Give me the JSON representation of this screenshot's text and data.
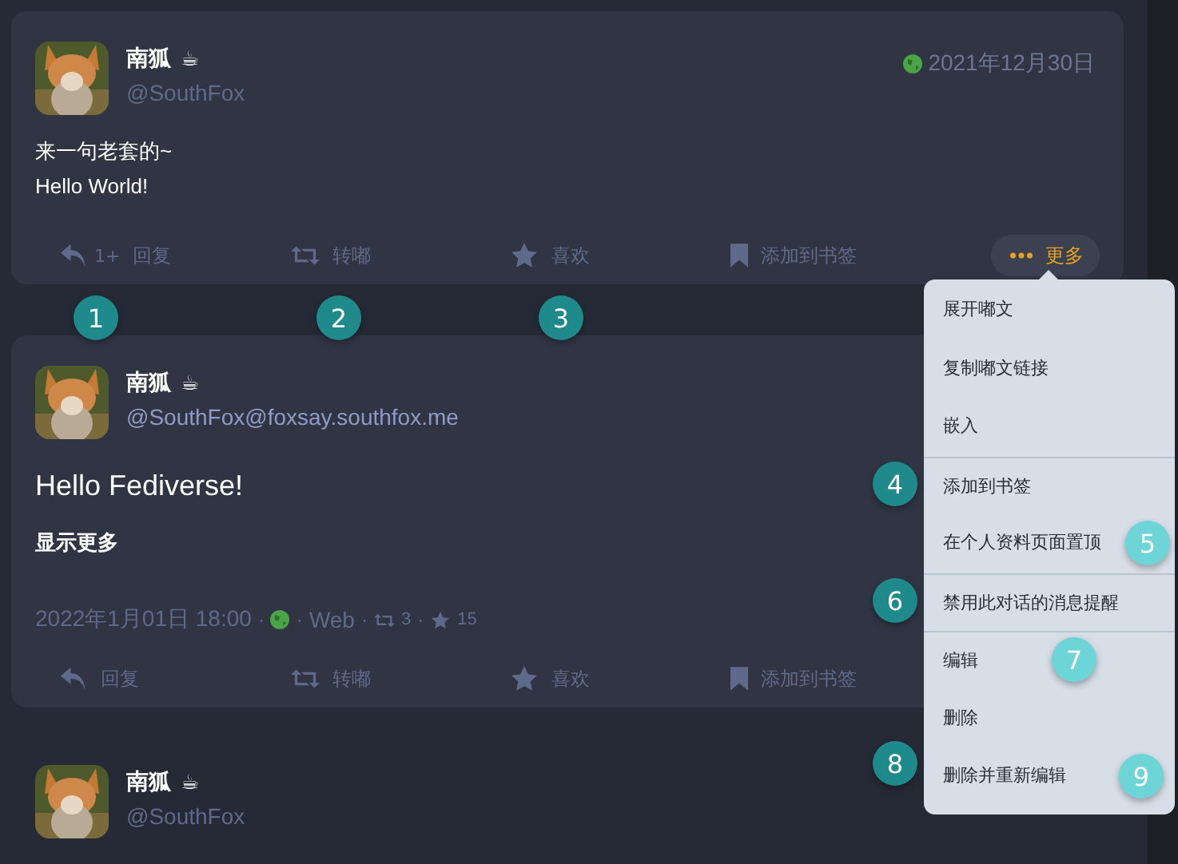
{
  "posts": [
    {
      "name": "南狐",
      "name_emoji": "☕",
      "handle": "@SouthFox",
      "date": "2021年12月30日",
      "public": true,
      "body": [
        "来一句老套的~",
        "Hello World!"
      ],
      "actions": [
        {
          "kind": "reply",
          "label": "回复",
          "count": "1+"
        },
        {
          "kind": "boost",
          "label": "转嘟"
        },
        {
          "kind": "favourite",
          "label": "喜欢"
        },
        {
          "kind": "bookmark",
          "label": "添加到书签"
        },
        {
          "kind": "more",
          "label": "更多",
          "selected": true
        }
      ]
    },
    {
      "name": "南狐",
      "name_emoji": "☕",
      "handle": "@SouthFox@foxsay.southfox.me",
      "large": true,
      "body": [
        "Hello Fediverse!"
      ],
      "show_more": "显示更多",
      "meta": {
        "time": "2022年1月01日 18:00",
        "public": true,
        "app": "Web",
        "boosts": "3",
        "favourites": "15",
        "separator": "·"
      },
      "actions": [
        {
          "kind": "reply",
          "label": "回复"
        },
        {
          "kind": "boost",
          "label": "转嘟"
        },
        {
          "kind": "favourite",
          "label": "喜欢"
        },
        {
          "kind": "bookmark",
          "label": "添加到书签"
        }
      ]
    },
    {
      "name": "南狐",
      "name_emoji": "☕",
      "handle": "@SouthFox"
    }
  ],
  "menu": {
    "groups": [
      [
        "展开嘟文",
        "复制嘟文链接",
        "嵌入"
      ],
      [
        "添加到书签",
        "在个人资料页面置顶"
      ],
      [
        "禁用此对话的消息提醒"
      ],
      [
        "编辑",
        "删除",
        "删除并重新编辑"
      ]
    ]
  },
  "callouts": [
    {
      "label": "1",
      "color": "#1f8a8c"
    },
    {
      "label": "2",
      "color": "#1f8a8c"
    },
    {
      "label": "3",
      "color": "#1f8a8c"
    },
    {
      "label": "4",
      "color": "#1f8a8c"
    },
    {
      "label": "5",
      "color": "#6dd5d8"
    },
    {
      "label": "6",
      "color": "#1f8a8c"
    },
    {
      "label": "7",
      "color": "#6dd5d8"
    },
    {
      "label": "8",
      "color": "#1f8a8c"
    },
    {
      "label": "9",
      "color": "#6dd5d8"
    }
  ]
}
